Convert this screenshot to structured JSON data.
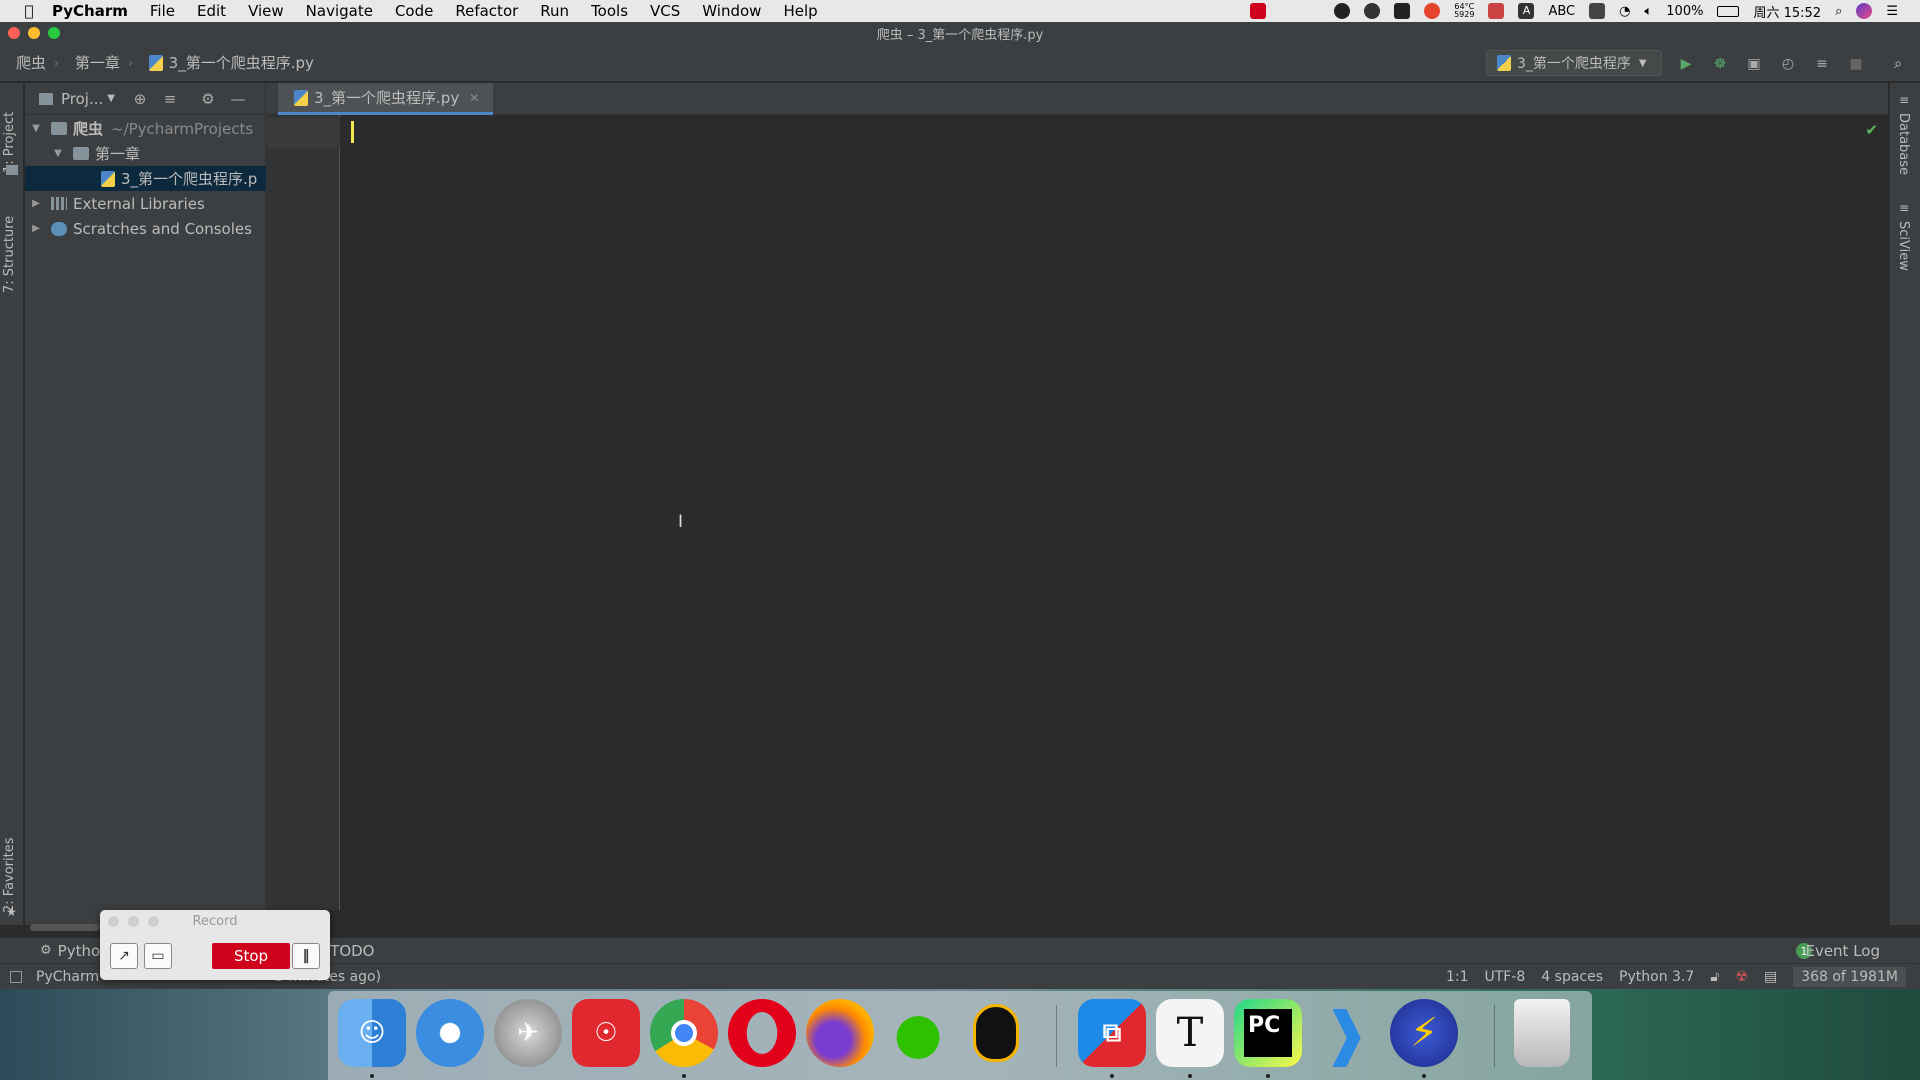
{
  "menubar": {
    "app_name": "PyCharm",
    "menus": [
      "File",
      "Edit",
      "View",
      "Navigate",
      "Code",
      "Refactor",
      "Run",
      "Tools",
      "VCS",
      "Window",
      "Help"
    ],
    "tray": {
      "temp_top": "64°C",
      "temp_bottom": "5929",
      "input_label": "ABC",
      "battery": "100%",
      "clock": "周六 15:52"
    }
  },
  "window": {
    "title": "爬虫 – 3_第一个爬虫程序.py"
  },
  "navbar": {
    "crumbs": [
      "爬虫",
      "第一章",
      "3_第一个爬虫程序.py"
    ],
    "run_config": "3_第一个爬虫程序"
  },
  "left_strip": {
    "project_tab": "1: Project",
    "structure_tab": "7: Structure",
    "favorites_tab": "2: Favorites"
  },
  "project_panel": {
    "title": "Proj...",
    "tree": {
      "root_name": "爬虫",
      "root_path": "~/PycharmProjects",
      "chapter": "第一章",
      "file": "3_第一个爬虫程序.p",
      "external": "External Libraries",
      "scratches": "Scratches and Consoles"
    }
  },
  "editor": {
    "tab_label": "3_第一个爬虫程序.py"
  },
  "right_strip": {
    "database_tab": "Database",
    "sciview_tab": "SciView"
  },
  "bottom_bar": {
    "python_tab": "Pytho",
    "todo_tab": "TODO",
    "event_count": "1",
    "event_log": "Event Log"
  },
  "status_bar": {
    "message": "PyCharm",
    "message_tail": "3 minutes ago)",
    "position": "1:1",
    "encoding": "UTF-8",
    "indent": "4 spaces",
    "interpreter": "Python 3.7",
    "memory": "368 of 1981M"
  },
  "record_widget": {
    "title": "Record",
    "stop_label": "Stop"
  },
  "colors": {
    "editor_bg": "#2b2b2b",
    "panel_bg": "#3c3f41",
    "accent": "#4a88c7",
    "stop_red": "#d0021b",
    "caret": "#f0e650"
  },
  "dock_apps": [
    "finder-icon",
    "safari-icon",
    "launchpad-icon",
    "netease-music-icon",
    "chrome-icon",
    "opera-icon",
    "firefox-icon",
    "wechat-icon",
    "qq-icon",
    "vmware-icon",
    "typora-icon",
    "pycharm-icon",
    "vscode-icon",
    "thunder-icon",
    "trash-icon"
  ]
}
